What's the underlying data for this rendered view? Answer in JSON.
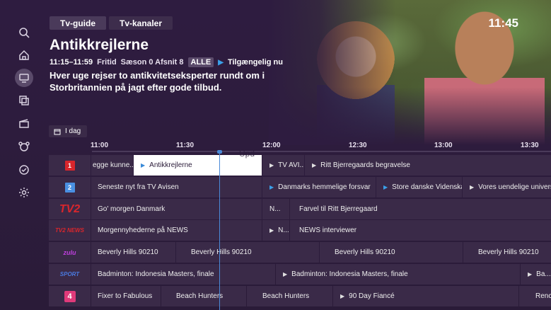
{
  "tabs": [
    {
      "label": "Tv-guide"
    },
    {
      "label": "Tv-kanaler"
    }
  ],
  "clock": "11:45",
  "program": {
    "title": "Antikkrejlerne",
    "time": "11:15–11:59",
    "genre": "Fritid",
    "episode": "Sæson 0 Afsnit 8",
    "rating": "ALLE",
    "availability": "Tilgængelig nu",
    "description": "Hver uge rejser to antikvitetseksperter rundt om i Storbritannien på jagt efter gode tilbud."
  },
  "day_button": "I dag",
  "overlay_text": "Upd",
  "time_ticks": [
    "11:00",
    "11:30",
    "12:00",
    "12:30",
    "13:00",
    "13:30"
  ],
  "channels": [
    {
      "name": "DR1",
      "logo": "1",
      "programs": [
        {
          "title": "egge kunne...",
          "arrow": false
        },
        {
          "title": "Antikkrejlerne",
          "arrow": true,
          "selected": true
        },
        {
          "title": "TV AVI...",
          "arrow": true
        },
        {
          "title": "Ritt Bjerregaards begravelse",
          "arrow": true
        }
      ]
    },
    {
      "name": "DR2",
      "logo": "2",
      "programs": [
        {
          "title": "Seneste nyt fra TV Avisen",
          "arrow": false
        },
        {
          "title": "Danmarks hemmelige forsvar",
          "arrow": true,
          "blue": true
        },
        {
          "title": "Store danske Videnskabsfolk",
          "arrow": true,
          "blue": true
        },
        {
          "title": "Vores uendelige univers",
          "arrow": true
        }
      ]
    },
    {
      "name": "TV 2",
      "logo": "TV2",
      "programs": [
        {
          "title": "Go' morgen Danmark",
          "arrow": false
        },
        {
          "title": "N...",
          "arrow": false
        },
        {
          "title": "Farvel til Ritt Bjerregaard",
          "arrow": false
        }
      ]
    },
    {
      "name": "TV 2 NEWS",
      "logo": "TV2 NEWS",
      "programs": [
        {
          "title": "Morgennyhederne på NEWS",
          "arrow": false
        },
        {
          "title": "N...",
          "arrow": true
        },
        {
          "title": "NEWS interviewer",
          "arrow": false
        }
      ]
    },
    {
      "name": "TV 2 Zulu",
      "logo": "zulu",
      "programs": [
        {
          "title": "Beverly Hills 90210",
          "arrow": false
        },
        {
          "title": "Beverly Hills 90210",
          "arrow": false
        },
        {
          "title": "Beverly Hills 90210",
          "arrow": false
        },
        {
          "title": "Beverly Hills 90210",
          "arrow": false
        }
      ]
    },
    {
      "name": "TV 2 Sport",
      "logo": "SPORT",
      "programs": [
        {
          "title": "Badminton: Indonesia Masters, finale",
          "arrow": false
        },
        {
          "title": "Badminton: Indonesia Masters, finale",
          "arrow": true
        },
        {
          "title": "Ba...",
          "arrow": true
        }
      ]
    },
    {
      "name": "Kanal 4",
      "logo": "4",
      "programs": [
        {
          "title": "Fixer to Fabulous",
          "arrow": false
        },
        {
          "title": "Beach Hunters",
          "arrow": false
        },
        {
          "title": "Beach Hunters",
          "arrow": false
        },
        {
          "title": "90 Day Fiancé",
          "arrow": true
        },
        {
          "title": "Renc...",
          "arrow": false
        }
      ]
    }
  ],
  "colors": {
    "background": "#2d1c3d",
    "cell": "#3a2a48",
    "selected_cell": "#ffffff",
    "accent_blue": "#3aa0e8",
    "dr_red": "#d8262c",
    "dr2_blue": "#4a90e2",
    "tv2_red": "#d8262c",
    "zulu_pink": "#c040e0",
    "sport_blue": "#4a7ae0",
    "k4_pink": "#e03a7a"
  }
}
